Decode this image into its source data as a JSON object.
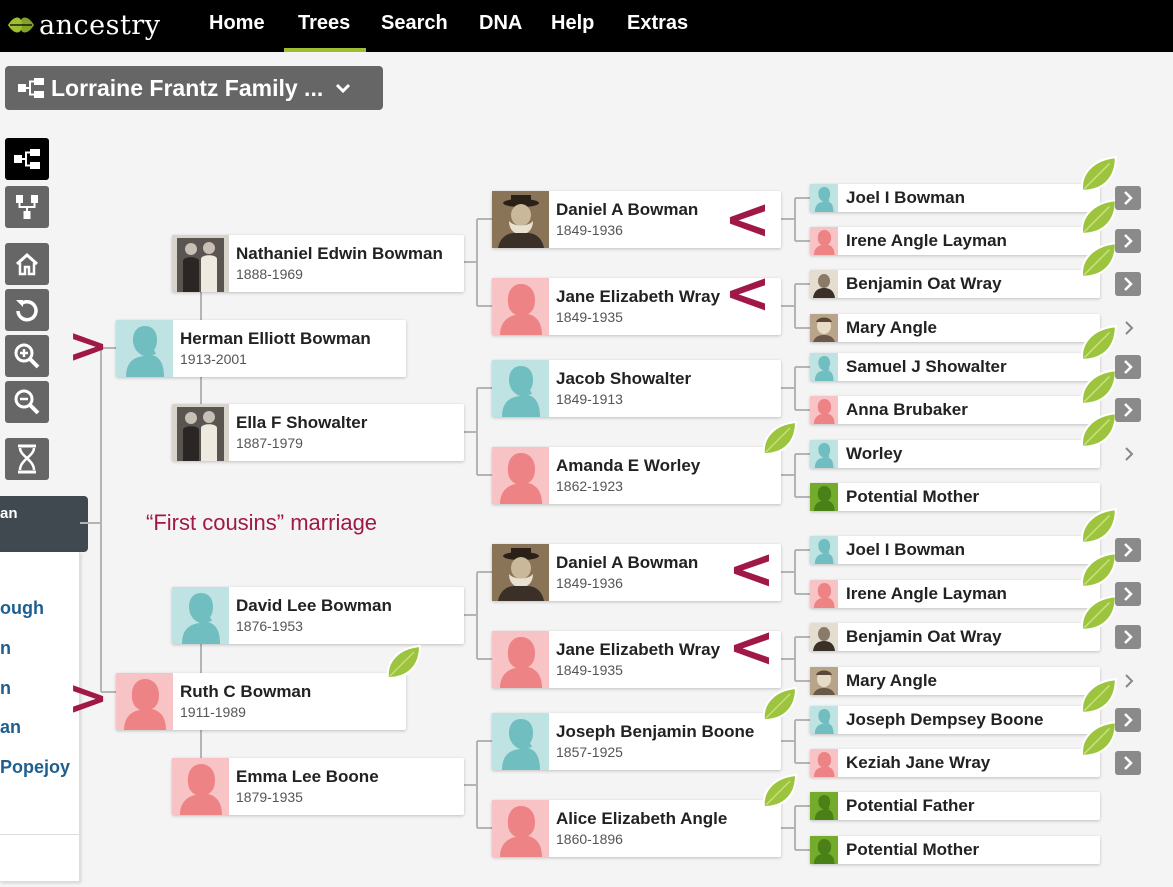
{
  "nav": {
    "logo": "ancestry",
    "items": [
      {
        "label": "Home",
        "active": false
      },
      {
        "label": "Trees",
        "active": true
      },
      {
        "label": "Search",
        "active": false
      },
      {
        "label": "DNA",
        "active": false
      },
      {
        "label": "Help",
        "active": false
      },
      {
        "label": "Extras",
        "active": false
      }
    ]
  },
  "tree_selector": {
    "title": "Lorraine Frantz Family ..."
  },
  "toolbar": [
    "pedigree-view-icon",
    "family-view-icon",
    "home-icon",
    "reset-icon",
    "zoom-in-icon",
    "zoom-out-icon",
    "dna-icon"
  ],
  "side_panel": {
    "profile_label": "an",
    "links": [
      "ough",
      "n",
      "n",
      "an",
      "Popejoy"
    ]
  },
  "annotation": {
    "text": "“First cousins” marriage",
    "arrow_right": ">",
    "arrow_left": "<"
  },
  "colors": {
    "male": "#8ecfd0",
    "male_bg": "#bfe3e3",
    "female": "#f08c8f",
    "female_bg": "#f7c3c4",
    "potential": "#74ab2a",
    "hint_leaf": "#9cc43e",
    "annotation": "#a01848",
    "nav_active": "#9cbe30"
  },
  "people": {
    "herman": {
      "name": "Herman Elliott Bowman",
      "dates": "1913-2001"
    },
    "ruth": {
      "name": "Ruth C Bowman",
      "dates": "1911-1989"
    },
    "nathaniel": {
      "name": "Nathaniel Edwin Bowman",
      "dates": "1888-1969"
    },
    "ella": {
      "name": "Ella F Showalter",
      "dates": "1887-1979"
    },
    "david": {
      "name": "David Lee Bowman",
      "dates": "1876-1953"
    },
    "emma": {
      "name": "Emma Lee Boone",
      "dates": "1879-1935"
    },
    "daniel1": {
      "name": "Daniel A Bowman",
      "dates": "1849-1936"
    },
    "jane1": {
      "name": "Jane Elizabeth Wray",
      "dates": "1849-1935"
    },
    "jacob": {
      "name": "Jacob Showalter",
      "dates": "1849-1913"
    },
    "amanda": {
      "name": "Amanda E Worley",
      "dates": "1862-1923"
    },
    "daniel2": {
      "name": "Daniel A Bowman",
      "dates": "1849-1936"
    },
    "jane2": {
      "name": "Jane Elizabeth Wray",
      "dates": "1849-1935"
    },
    "joseph": {
      "name": "Joseph Benjamin Boone",
      "dates": "1857-1925"
    },
    "alice": {
      "name": "Alice Elizabeth Angle",
      "dates": "1860-1896"
    },
    "g1": {
      "name": "Joel I Bowman"
    },
    "g2": {
      "name": "Irene Angle Layman"
    },
    "g3": {
      "name": "Benjamin Oat Wray"
    },
    "g4": {
      "name": "Mary Angle"
    },
    "g5": {
      "name": "Samuel J Showalter"
    },
    "g6": {
      "name": "Anna Brubaker"
    },
    "g7": {
      "name": "Worley"
    },
    "g8": {
      "name": "Potential Mother"
    },
    "g9": {
      "name": "Joel I Bowman"
    },
    "g10": {
      "name": "Irene Angle Layman"
    },
    "g11": {
      "name": "Benjamin Oat Wray"
    },
    "g12": {
      "name": "Mary Angle"
    },
    "g13": {
      "name": "Joseph Dempsey Boone"
    },
    "g14": {
      "name": "Keziah Jane Wray"
    },
    "g15": {
      "name": "Potential Father"
    },
    "g16": {
      "name": "Potential Mother"
    }
  }
}
